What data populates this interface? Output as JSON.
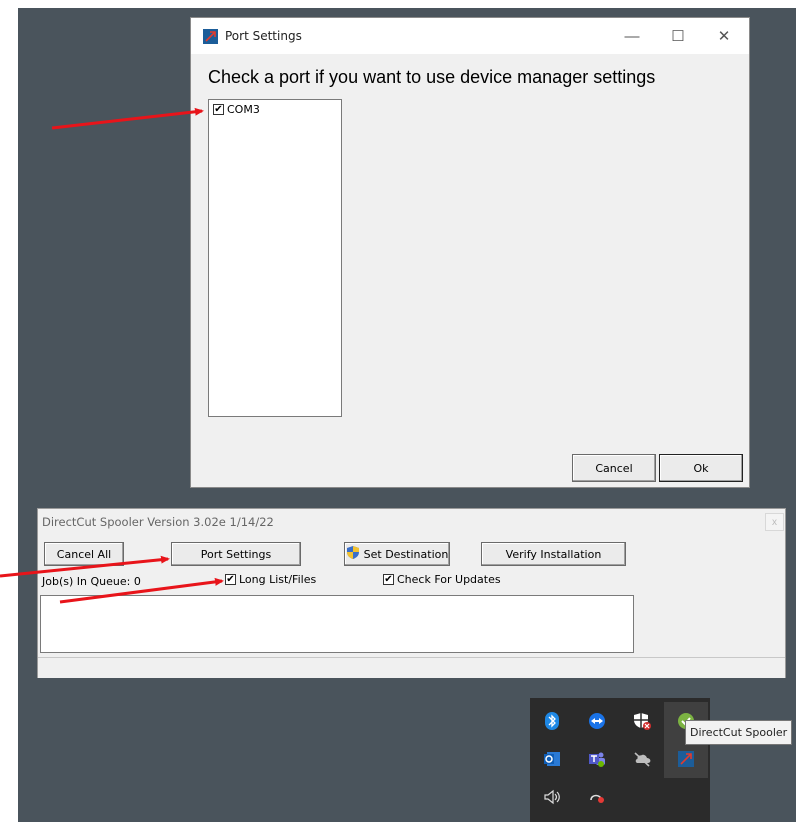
{
  "port_settings": {
    "title": "Port Settings",
    "instruction": "Check a port if you want to use device manager settings",
    "ports": [
      {
        "label": "COM3",
        "checked": true
      }
    ],
    "cancel_label": "Cancel",
    "ok_label": "Ok",
    "window_controls": {
      "minimize": "—",
      "maximize": "☐",
      "close": "✕"
    }
  },
  "spooler": {
    "title": "DirectCut Spooler Version 3.02e 1/14/22",
    "close_label": "x",
    "buttons": {
      "cancel_all": "Cancel All",
      "port_settings": "Port Settings",
      "set_destination": "Set Destination",
      "verify_installation": "Verify Installation"
    },
    "queue_label": "Job(s) In Queue: 0",
    "long_list": {
      "label": "Long List/Files",
      "checked": true
    },
    "check_updates": {
      "label": "Check For Updates",
      "checked": true
    }
  },
  "tray": {
    "tooltip": "DirectCut Spooler",
    "icons": [
      "bluetooth-icon",
      "teamviewer-icon",
      "security-shield-icon",
      "green-tray-icon",
      "outlook-icon",
      "teams-icon",
      "onedrive-icon",
      "directcut-spooler-icon",
      "speaker-icon",
      "record-icon"
    ]
  },
  "colors": {
    "desktop": "#4a545c",
    "window": "#f0f0f0",
    "annotation_arrow": "#e8141a",
    "app_icon": "#1c5d99"
  }
}
